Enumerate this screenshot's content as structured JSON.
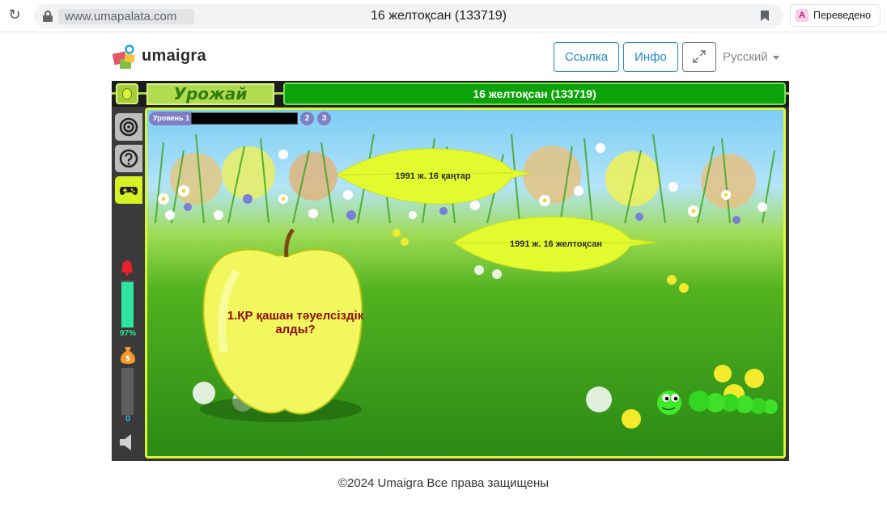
{
  "browser": {
    "url": "www.umapalata.com",
    "tab_title": "16 желтоқсан (133719)",
    "translated_label": "Переведено"
  },
  "site": {
    "logo_text": "umaigra",
    "link_button": "Ссылка",
    "info_button": "Инфо",
    "language": "Русский",
    "footer": "©2024 Umaigra Все права защищены"
  },
  "game": {
    "name": "Урожай",
    "title": "16 желтоқсан (133719)",
    "level_label": "Уровень 1",
    "level_numbers": [
      "2",
      "3"
    ],
    "progress_percent_label": "97%",
    "progress_percent": 97,
    "score": "0",
    "answers": [
      "1991 ж. 16 қаңтар",
      "1991 ж. 16 желтоқсан"
    ],
    "question": "1.ҚР қашан тәуелсіздік алды?"
  }
}
